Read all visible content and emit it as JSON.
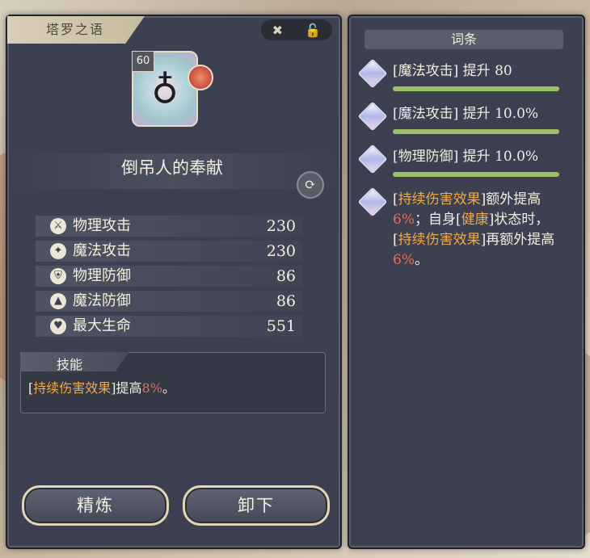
{
  "window": {
    "title": "塔罗之语"
  },
  "item": {
    "name": "倒吊人的奉献",
    "level": "60"
  },
  "stats": [
    {
      "icon": "sword-icon",
      "label": "物理攻击",
      "value": "230"
    },
    {
      "icon": "wand-icon",
      "label": "魔法攻击",
      "value": "230"
    },
    {
      "icon": "shield-icon",
      "label": "物理防御",
      "value": "86"
    },
    {
      "icon": "hat-icon",
      "label": "魔法防御",
      "value": "86"
    },
    {
      "icon": "heart-icon",
      "label": "最大生命",
      "value": "551"
    }
  ],
  "skill": {
    "title": "技能",
    "p1": "[",
    "keyword": "持续伤害效果",
    "p2": "]提高",
    "percent": "8%",
    "p3": "。"
  },
  "buttons": {
    "refine": "精炼",
    "unequip": "卸下"
  },
  "affix_panel": {
    "title": "词条",
    "affixes": [
      {
        "text": "[魔法攻击] 提升 80"
      },
      {
        "text": "[魔法攻击] 提升 10.0%"
      },
      {
        "text": "[物理防御] 提升 10.0%"
      }
    ],
    "special": {
      "a1": "[",
      "k1": "持续伤害效果",
      "a2": "]额外提高",
      "v1": "6%",
      "a3": "；自身[",
      "k2": "健康",
      "a4": "]状态时，[",
      "k3": "持续伤害效果",
      "a5": "]再额外提高",
      "v2": "6%",
      "a6": "。"
    }
  },
  "colors": {
    "panel": "#3c4050",
    "keyword": "#f0a94a",
    "value": "#e66e5a",
    "bar": "#9bc166"
  }
}
